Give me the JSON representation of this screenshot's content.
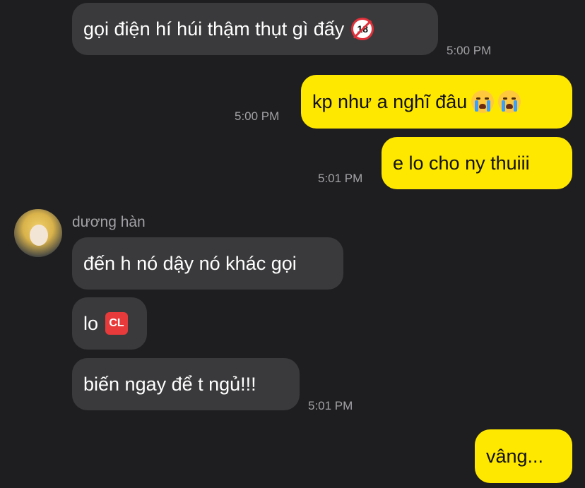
{
  "messages": [
    {
      "text": "gọi điện hí húi thậm thụt gì đấy",
      "emoji": "no-under-18-emoji",
      "time": "5:00 PM"
    },
    {
      "text": "kp như a nghĩ đâu",
      "emoji": "crying-face-emoji",
      "time": "5:00 PM"
    },
    {
      "text": "e lo cho ny thuiii",
      "time": "5:01 PM"
    },
    {
      "text": "đến h nó dậy nó khác gọi"
    },
    {
      "text": "lo",
      "emoji": "cl-button-emoji",
      "emoji_text": "CL"
    },
    {
      "text": "biến ngay để t ngủ!!!",
      "time": "5:01 PM"
    },
    {
      "text": "vâng..."
    }
  ],
  "sender": {
    "name": "dương hàn"
  },
  "badges": {
    "age": "18"
  },
  "colors": {
    "background": "#1e1e20",
    "incoming": "#3a3a3c",
    "outgoing": "#ffe800",
    "timestamp": "#a2a2a6"
  }
}
